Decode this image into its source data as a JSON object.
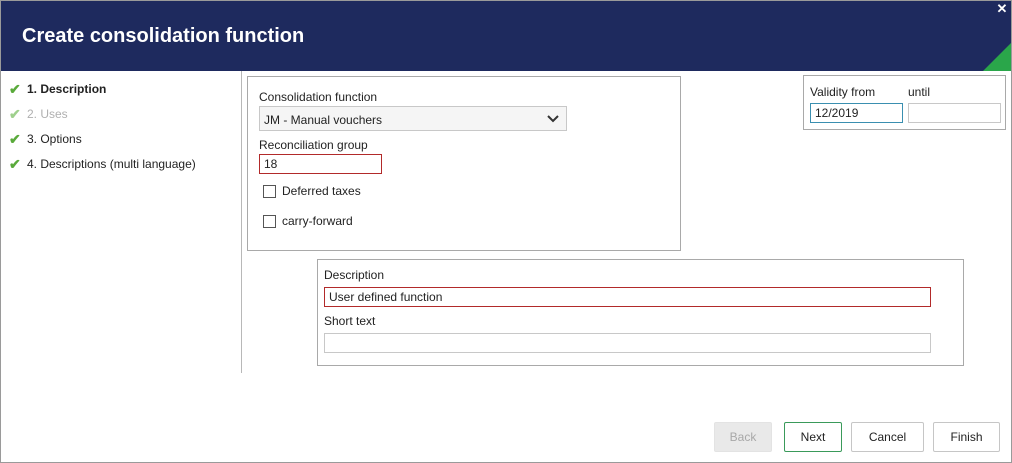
{
  "window": {
    "title": "Create consolidation function",
    "close_glyph": "✕"
  },
  "steps": [
    {
      "label": "1. Description",
      "state": "active"
    },
    {
      "label": "2. Uses",
      "state": "disabled"
    },
    {
      "label": "3. Options",
      "state": "done"
    },
    {
      "label": "4. Descriptions (multi language)",
      "state": "done"
    }
  ],
  "function_box": {
    "consolidation_function_label": "Consolidation function",
    "consolidation_function_value": "JM - Manual vouchers",
    "reconciliation_group_label": "Reconciliation group",
    "reconciliation_group_value": "18",
    "deferred_taxes_label": "Deferred taxes",
    "deferred_taxes_checked": false,
    "carry_forward_label": "carry-forward",
    "carry_forward_checked": false
  },
  "validity": {
    "from_label": "Validity from",
    "from_value": "12/2019",
    "until_label": "until",
    "until_value": ""
  },
  "description_box": {
    "description_label": "Description",
    "description_value": "User defined function",
    "short_text_label": "Short text",
    "short_text_value": ""
  },
  "buttons": {
    "back": "Back",
    "next": "Next",
    "cancel": "Cancel",
    "finish": "Finish"
  },
  "colors": {
    "header_bg": "#1e2a5e",
    "accent_green": "#2aa64a",
    "error_border": "#b22a2a"
  }
}
